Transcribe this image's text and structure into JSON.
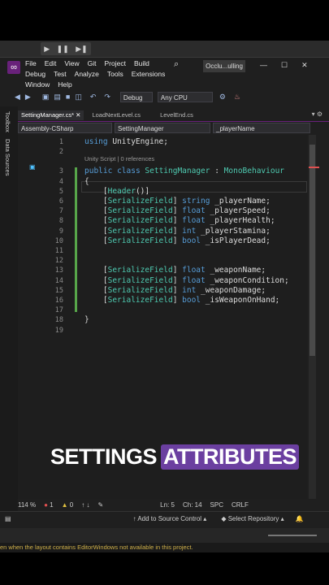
{
  "unity": {
    "play_icons": [
      "▶",
      "❚❚",
      "▶❚"
    ],
    "bottom_message": "en when the layout contains EditorWindows not available in this project."
  },
  "vs": {
    "menu_row1": [
      "File",
      "Edit",
      "View",
      "Git",
      "Project",
      "Build"
    ],
    "menu_row2": [
      "Debug",
      "Test",
      "Analyze",
      "Tools",
      "Extensions"
    ],
    "menu_row3": [
      "Window",
      "Help"
    ],
    "search_icon": "⌕",
    "title": "Occlu...ulling",
    "win_controls": [
      "—",
      "☐",
      "✕"
    ],
    "config": "Debug",
    "platform": "Any CPU",
    "tabs": [
      {
        "label": "SettingManager.cs*",
        "active": true
      },
      {
        "label": "LoadNextLevel.cs",
        "active": false
      },
      {
        "label": "LevelEnd.cs",
        "active": false
      }
    ],
    "side_tabs": [
      "Toolbox",
      "Data Sources"
    ],
    "nav": {
      "project": "Assembly-CSharp",
      "class": "SettingManager",
      "member": "_playerName"
    },
    "codelens": "Unity Script | 0 references",
    "zoom": "114 %",
    "errors": "1",
    "warnings": "0",
    "cursor_line": "Ln: 5",
    "cursor_col": "Ch: 14",
    "spc": "SPC",
    "crlf": "CRLF",
    "add_source": "Add to Source Control",
    "select_repo": "Select Repository"
  },
  "code_lines": [
    {
      "n": "1",
      "tokens": [
        [
          "kw",
          "using"
        ],
        [
          "id",
          " UnityEngine;"
        ]
      ]
    },
    {
      "n": "2",
      "tokens": []
    },
    {
      "n": "3",
      "tokens": [
        [
          "kw",
          "public"
        ],
        [
          "id",
          " "
        ],
        [
          "kw",
          "class"
        ],
        [
          "id",
          " "
        ],
        [
          "ty",
          "SettingManager"
        ],
        [
          "id",
          " : "
        ],
        [
          "ty",
          "MonoBehaviour"
        ]
      ]
    },
    {
      "n": "4",
      "tokens": [
        [
          "br",
          "{"
        ]
      ]
    },
    {
      "n": "5",
      "tokens": [
        [
          "id",
          "    ["
        ],
        [
          "at",
          "Header"
        ],
        [
          "id",
          "()]"
        ]
      ]
    },
    {
      "n": "6",
      "tokens": [
        [
          "id",
          "    ["
        ],
        [
          "at",
          "SerializeField"
        ],
        [
          "id",
          "] "
        ],
        [
          "kw",
          "string"
        ],
        [
          "id",
          " _playerName;"
        ]
      ]
    },
    {
      "n": "7",
      "tokens": [
        [
          "id",
          "    ["
        ],
        [
          "at",
          "SerializeField"
        ],
        [
          "id",
          "] "
        ],
        [
          "kw",
          "float"
        ],
        [
          "id",
          " _playerSpeed;"
        ]
      ]
    },
    {
      "n": "8",
      "tokens": [
        [
          "id",
          "    ["
        ],
        [
          "at",
          "SerializeField"
        ],
        [
          "id",
          "] "
        ],
        [
          "kw",
          "float"
        ],
        [
          "id",
          " _playerHealth;"
        ]
      ]
    },
    {
      "n": "9",
      "tokens": [
        [
          "id",
          "    ["
        ],
        [
          "at",
          "SerializeField"
        ],
        [
          "id",
          "] "
        ],
        [
          "kw",
          "int"
        ],
        [
          "id",
          " _playerStamina;"
        ]
      ]
    },
    {
      "n": "10",
      "tokens": [
        [
          "id",
          "    ["
        ],
        [
          "at",
          "SerializeField"
        ],
        [
          "id",
          "] "
        ],
        [
          "kw",
          "bool"
        ],
        [
          "id",
          " _isPlayerDead;"
        ]
      ]
    },
    {
      "n": "11",
      "tokens": []
    },
    {
      "n": "12",
      "tokens": []
    },
    {
      "n": "13",
      "tokens": [
        [
          "id",
          "    ["
        ],
        [
          "at",
          "SerializeField"
        ],
        [
          "id",
          "] "
        ],
        [
          "kw",
          "float"
        ],
        [
          "id",
          " _weaponName;"
        ]
      ]
    },
    {
      "n": "14",
      "tokens": [
        [
          "id",
          "    ["
        ],
        [
          "at",
          "SerializeField"
        ],
        [
          "id",
          "] "
        ],
        [
          "kw",
          "float"
        ],
        [
          "id",
          " _weaponCondition;"
        ]
      ]
    },
    {
      "n": "15",
      "tokens": [
        [
          "id",
          "    ["
        ],
        [
          "at",
          "SerializeField"
        ],
        [
          "id",
          "] "
        ],
        [
          "kw",
          "int"
        ],
        [
          "id",
          " _weaponDamage;"
        ]
      ]
    },
    {
      "n": "16",
      "tokens": [
        [
          "id",
          "    ["
        ],
        [
          "at",
          "SerializeField"
        ],
        [
          "id",
          "] "
        ],
        [
          "kw",
          "bool"
        ],
        [
          "id",
          " _isWeaponOnHand;"
        ]
      ]
    },
    {
      "n": "17",
      "tokens": []
    },
    {
      "n": "18",
      "tokens": [
        [
          "br",
          "}"
        ]
      ]
    },
    {
      "n": "19",
      "tokens": []
    }
  ],
  "overlay": {
    "word1": "SETTINGS",
    "word2": "ATTRIBUTES"
  },
  "colors": {
    "keyword": "#569cd6",
    "type": "#4ec9b0",
    "highlight": "#6b3fa0",
    "vs_purple": "#68217a"
  }
}
